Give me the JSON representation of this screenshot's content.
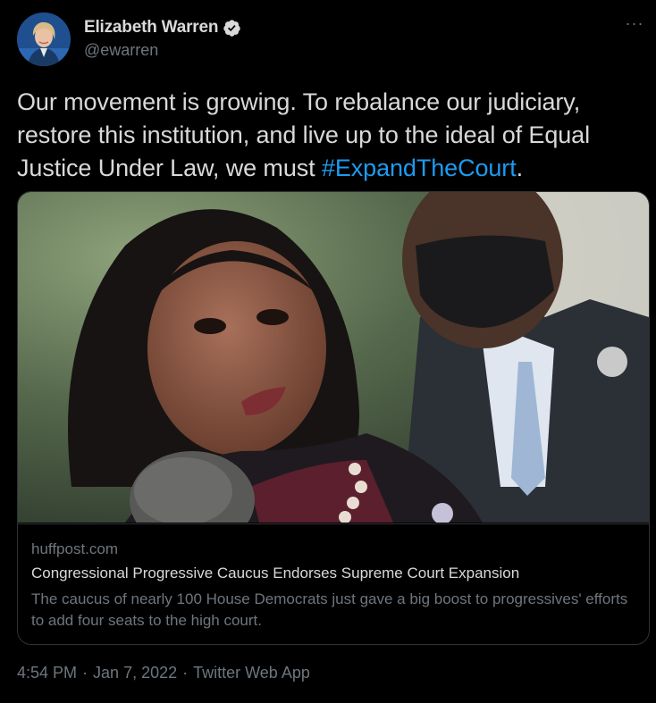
{
  "author": {
    "display_name": "Elizabeth Warren",
    "handle": "@ewarren",
    "verified_icon": "verified-badge-icon"
  },
  "more_button": {
    "label": "···",
    "icon": "more-horizontal-icon"
  },
  "tweet": {
    "text_before_hashtag": "Our movement is growing. To rebalance our judiciary, restore this institution, and live up to the ideal of Equal Justice Under Law, we must ",
    "hashtag": "#ExpandTheCourt",
    "text_after_hashtag": "."
  },
  "card": {
    "domain": "huffpost.com",
    "title": "Congressional Progressive Caucus Endorses Supreme Court Expansion",
    "description": "The caucus of nearly 100 House Democrats just gave a big boost to progressives' efforts to add four seats to the high court."
  },
  "meta": {
    "time": "4:54 PM",
    "separator": "·",
    "date": "Jan 7, 2022",
    "source": "Twitter Web App"
  },
  "colors": {
    "background": "#000000",
    "text": "#d9d9d9",
    "secondary": "#6e767d",
    "link": "#1d9bf0",
    "border": "#2f3336"
  }
}
